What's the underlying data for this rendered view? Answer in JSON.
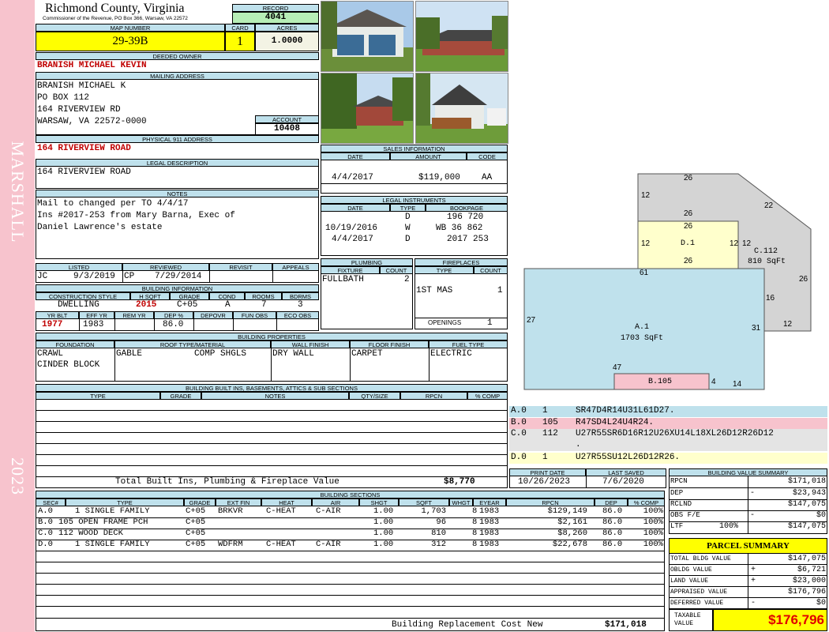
{
  "header": {
    "county": "Richmond County, Virginia",
    "commissioner": "Commissioner of the Revenue, PO Box 366, Warsaw, VA 22572",
    "record_label": "RECORD",
    "record": "4041",
    "map_number_label": "MAP NUMBER",
    "map_number": "29-39B",
    "card_label": "CARD",
    "card": "1",
    "acres_label": "ACRES",
    "acres": "1.0000"
  },
  "sidebar": {
    "district": "MARSHALL",
    "year": "2023"
  },
  "owner": {
    "deeded_owner_label": "DEEDED OWNER",
    "deeded_owner": "BRANISH MICHAEL KEVIN",
    "mailing_label": "MAILING ADDRESS",
    "mailing_lines": [
      "BRANISH MICHAEL K",
      "PO BOX 112",
      "164 RIVERVIEW RD",
      "WARSAW, VA 22572-0000"
    ],
    "account_label": "ACCOUNT",
    "account": "10408",
    "physical_label": "PHYSICAL 911 ADDRESS",
    "physical": "164 RIVERVIEW ROAD",
    "legal_label": "LEGAL DESCRIPTION",
    "legal": "164 RIVERVIEW ROAD",
    "notes_label": "NOTES",
    "notes_lines": [
      "Mail to changed per TO 4/4/17",
      "Ins #2017-253 from Mary Barna, Exec of",
      "Daniel Lawrence's estate"
    ]
  },
  "listing": {
    "listed_label": "LISTED",
    "reviewed_label": "REVIEWED",
    "revisit_label": "REVISIT",
    "appeals_label": "APPEALS",
    "listed_by": "JC",
    "listed_date": "9/3/2019",
    "reviewed_by": "CP",
    "reviewed_date": "7/29/2014"
  },
  "building_info": {
    "title": "BUILDING INFORMATION",
    "headers": [
      "CONSTRUCTION STYLE",
      "H SQFT",
      "GRADE",
      "COND",
      "ROOMS",
      "BDRMS"
    ],
    "values": [
      "DWELLING",
      "2015",
      "C+05",
      "A",
      "7",
      "3"
    ],
    "headers2": [
      "YR BLT",
      "EFF YR",
      "REM YR",
      "DEP %",
      "DEPOVR",
      "FUN OBS",
      "ECO OBS"
    ],
    "values2": [
      "1977",
      "1983",
      "",
      "86.0",
      "",
      "",
      ""
    ]
  },
  "sales": {
    "title": "SALES INFORMATION",
    "headers": [
      "DATE",
      "AMOUNT",
      "CODE"
    ],
    "rows": [
      {
        "date": "4/4/2017",
        "amount": "$119,000",
        "code": "AA"
      }
    ]
  },
  "instruments": {
    "title": "LEGAL INSTRUMENTS",
    "headers": [
      "DATE",
      "TYPE",
      "BOOKPAGE"
    ],
    "rows": [
      {
        "date": "",
        "type": "D",
        "bookpage": "196 720"
      },
      {
        "date": "10/19/2016",
        "type": "W",
        "bookpage": "WB 36 862"
      },
      {
        "date": "4/4/2017",
        "type": "D",
        "bookpage": "2017 253"
      }
    ]
  },
  "plumbing": {
    "title": "PLUMBING",
    "headers": [
      "FIXTURE",
      "COUNT"
    ],
    "rows": [
      {
        "fixture": "FULLBATH",
        "count": "2"
      }
    ]
  },
  "fireplaces": {
    "title": "FIREPLACES",
    "headers": [
      "TYPE",
      "COUNT"
    ],
    "rows": [
      {
        "type": "1ST MAS",
        "count": "1"
      }
    ],
    "openings_label": "OPENINGS",
    "openings": "1"
  },
  "properties": {
    "title": "BUILDING PROPERTIES",
    "headers": [
      "FOUNDATION",
      "ROOF TYPE/MATERIAL",
      "WALL FINISH",
      "FLOOR FINISH",
      "FUEL TYPE"
    ],
    "foundation": [
      "CRAWL",
      "CINDER BLOCK"
    ],
    "roof_type": "GABLE",
    "roof_material": "COMP SHGLS",
    "wall": "DRY WALL",
    "floor": "CARPET",
    "fuel": "ELECTRIC"
  },
  "builtins": {
    "title": "BUILDING BUILT INS, BASEMENTS, ATTICS & SUB SECTIONS",
    "headers": [
      "TYPE",
      "GRADE",
      "NOTES",
      "QTY/SIZE",
      "RPCN",
      "% COMP"
    ],
    "total_label": "Total Built Ins, Plumbing & Fireplace Value",
    "total": "$8,770"
  },
  "print": {
    "print_label": "PRINT DATE",
    "saved_label": "LAST SAVED",
    "print_date": "10/26/2023",
    "last_saved": "7/6/2020"
  },
  "segments": [
    {
      "code": "A.0",
      "num": "1",
      "desc": "SR47D4R14U31L61D27.",
      "bg": "#bfe1ec"
    },
    {
      "code": "B.0",
      "num": "105",
      "desc": "R47SD4L24U4R24.",
      "bg": "#f7c3cd"
    },
    {
      "code": "C.0",
      "num": "112",
      "desc": "U27R55SR6D16R12U26XU14L18XL26D12R26D12",
      "desc2": ".",
      "bg": "#e4e4e4"
    },
    {
      "code": "D.0",
      "num": "1",
      "desc": "U27R55SU12L26D12R26.",
      "bg": "#ffffcc"
    }
  ],
  "sketch": {
    "labels": {
      "a_name": "A.1",
      "a_area": "1703 SqFt",
      "b_name": "B.105",
      "c_name": "C.112",
      "c_area": "810 SqFt",
      "d_name": "D.1"
    },
    "dims": [
      "26",
      "12",
      "22",
      "26",
      "26",
      "12",
      "12",
      "12",
      "26",
      "61",
      "26",
      "27",
      "16",
      "31",
      "12",
      "47",
      "4",
      "14"
    ]
  },
  "value_summary": {
    "title": "BUILDING VALUE SUMMARY",
    "rows": [
      {
        "label": "RPCN",
        "sign": "",
        "pct": "",
        "value": "$171,018"
      },
      {
        "label": "DEP",
        "sign": "-",
        "pct": "",
        "value": "$23,943"
      },
      {
        "label": "RCLND",
        "sign": "",
        "pct": "",
        "value": "$147,075"
      },
      {
        "label": "OBS F/E",
        "sign": "-",
        "pct": "",
        "value": "$0"
      },
      {
        "label": "LTF",
        "sign": "",
        "pct": "100%",
        "value": "$147,075"
      }
    ]
  },
  "parcel_summary": {
    "title": "PARCEL SUMMARY",
    "rows": [
      {
        "label": "TOTAL BLDG VALUE",
        "sign": "",
        "value": "$147,075"
      },
      {
        "label": "OBLDG VALUE",
        "sign": "+",
        "value": "$6,721"
      },
      {
        "label": "LAND VALUE",
        "sign": "+",
        "value": "$23,000"
      },
      {
        "label": "APPRAISED VALUE",
        "sign": "",
        "value": "$176,796"
      },
      {
        "label": "DEFERRED VALUE",
        "sign": "-",
        "value": "$0"
      }
    ],
    "taxable_label": "TAXABLE VALUE",
    "taxable": "$176,796"
  },
  "sections": {
    "title": "BUILDING SECTIONS",
    "headers": [
      "SEC#",
      "TYPE",
      "GRADE",
      "EXT FIN",
      "HEAT",
      "AIR",
      "SHGT",
      "SQFT",
      "WHGT",
      "EYEAR",
      "RPCN",
      "DEP",
      "% COMP"
    ],
    "rows": [
      {
        "sec": "A.0",
        "type": "1 SINGLE FAMILY",
        "grade": "C+05",
        "ext": "BRKVR",
        "heat": "C-HEAT",
        "air": "C-AIR",
        "shgt": "1.00",
        "sqft": "1,703",
        "whgt": "8",
        "eyear": "1983",
        "rpcn": "$129,149",
        "dep": "86.0",
        "comp": "100%"
      },
      {
        "sec": "B.0",
        "type": "105 OPEN FRAME PCH",
        "grade": "C+05",
        "ext": "",
        "heat": "",
        "air": "",
        "shgt": "1.00",
        "sqft": "96",
        "whgt": "8",
        "eyear": "1983",
        "rpcn": "$2,161",
        "dep": "86.0",
        "comp": "100%"
      },
      {
        "sec": "C.0",
        "type": "112 WOOD DECK",
        "grade": "C+05",
        "ext": "",
        "heat": "",
        "air": "",
        "shgt": "1.00",
        "sqft": "810",
        "whgt": "8",
        "eyear": "1983",
        "rpcn": "$8,260",
        "dep": "86.0",
        "comp": "100%"
      },
      {
        "sec": "D.0",
        "type": "1 SINGLE FAMILY",
        "grade": "C+05",
        "ext": "WDFRM",
        "heat": "C-HEAT",
        "air": "C-AIR",
        "shgt": "1.00",
        "sqft": "312",
        "whgt": "8",
        "eyear": "1983",
        "rpcn": "$22,678",
        "dep": "86.0",
        "comp": "100%"
      }
    ],
    "replacement_label": "Building Replacement Cost New",
    "replacement": "$171,018"
  }
}
